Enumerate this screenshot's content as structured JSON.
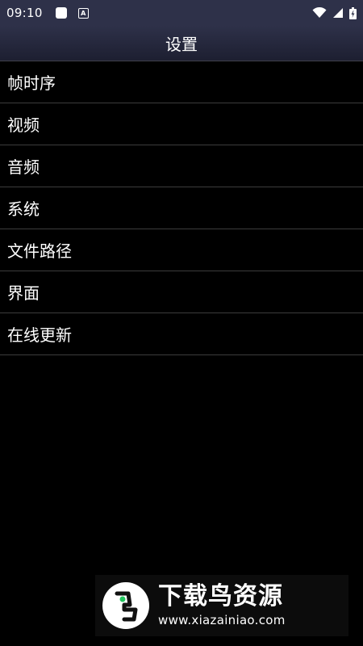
{
  "status_bar": {
    "time": "09:10",
    "icons": [
      "app-notification-icon",
      "keyboard-a-icon",
      "wifi-icon",
      "signal-icon",
      "battery-icon"
    ]
  },
  "header": {
    "title": "设置"
  },
  "menu": {
    "items": [
      {
        "label": "帧时序"
      },
      {
        "label": "视频"
      },
      {
        "label": "音频"
      },
      {
        "label": "系统"
      },
      {
        "label": "文件路径"
      },
      {
        "label": "界面"
      },
      {
        "label": "在线更新"
      }
    ]
  },
  "watermark": {
    "brand": "下载鸟资源",
    "url": "www.xiazainiao.com"
  },
  "colors": {
    "status_bar": "#2e3149",
    "background": "#000000",
    "divider": "#3c3c3c",
    "text": "#ffffff"
  }
}
